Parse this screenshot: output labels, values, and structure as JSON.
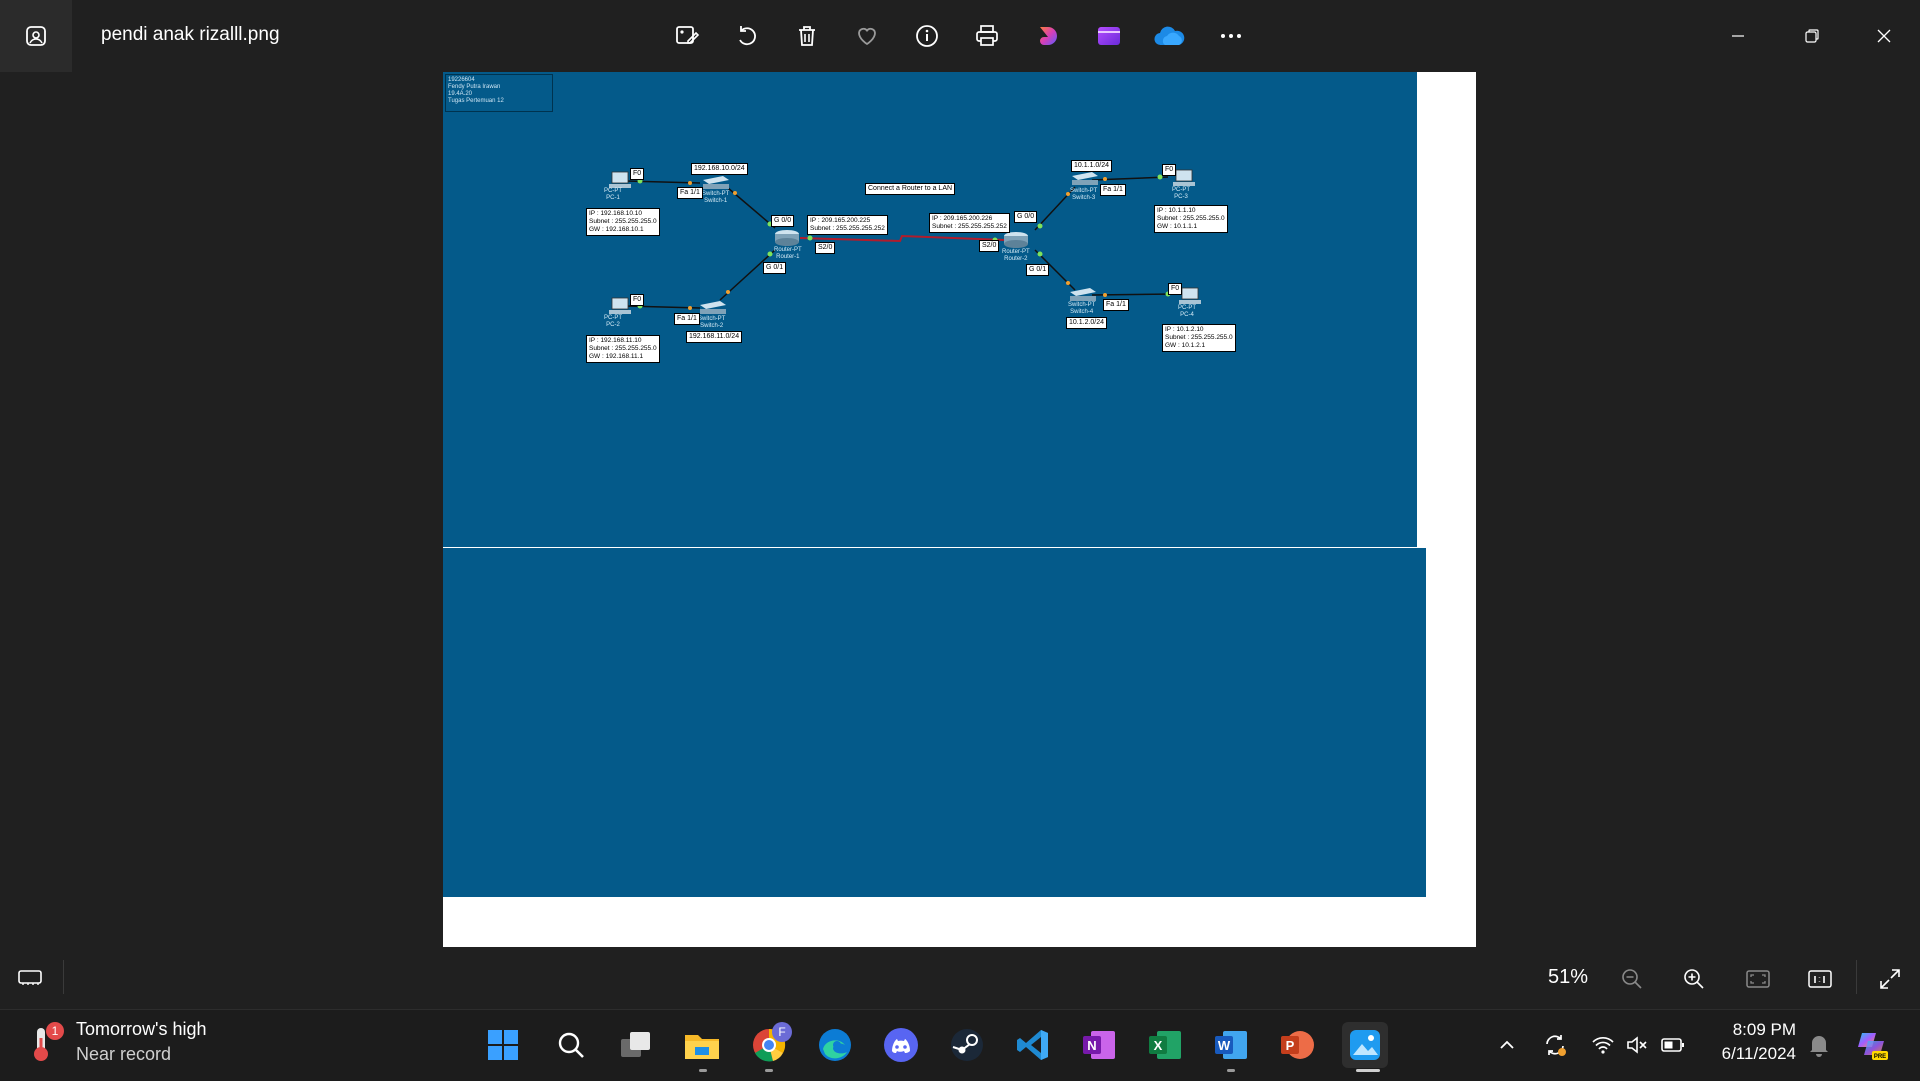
{
  "window": {
    "title": "pendi anak rizalll.png",
    "toolbar": [
      "edit-image",
      "rotate",
      "delete",
      "favorite",
      "file-info",
      "print",
      "ai-designer",
      "clipchamp",
      "onedrive",
      "more-options"
    ]
  },
  "diagram": {
    "note_lines": [
      "19226604",
      "Fendy Putra Irawan",
      "19.4A.20",
      "Tugas Pertemuan 12"
    ],
    "title_label": "Connect a Router to a LAN",
    "nets": {
      "lan1": "192.168.10.0/24",
      "lan2": "192.168.11.0/24",
      "lan3": "10.1.1.0/24",
      "lan4": "10.1.2.0/24"
    },
    "ports": {
      "f0": "F0",
      "fa11": "Fa 1/1",
      "g00": "G 0/0",
      "g01": "G 0/1",
      "s20": "S2/0"
    },
    "devices": {
      "pc1": "PC-PT\nPC-1",
      "pc2": "PC-PT\nPC-2",
      "pc3": "PC-PT\nPC-3",
      "pc4": "PC-PT\nPC-4",
      "sw1": "Switch-PT\nSwitch-1",
      "sw2": "Switch-PT\nSwitch-2",
      "sw3": "Switch-PT\nSwitch-3",
      "sw4": "Switch-PT\nSwitch-4",
      "r1": "Router-PT\nRouter-1",
      "r2": "Router-PT\nRouter-2"
    },
    "info": {
      "pc1": [
        "IP : 192.168.10.10",
        "Subnet : 255.255.255.0",
        "GW : 192.168.10.1"
      ],
      "pc2": [
        "IP : 192.168.11.10",
        "Subnet : 255.255.255.0",
        "GW : 192.168.11.1"
      ],
      "pc3": [
        "IP : 10.1.1.10",
        "Subnet : 255.255.255.0",
        "GW : 10.1.1.1"
      ],
      "pc4": [
        "IP : 10.1.2.10",
        "Subnet : 255.255.255.0",
        "GW : 10.1.2.1"
      ],
      "r1": [
        "IP : 209.165.200.225",
        "Subnet : 255.255.255.252"
      ],
      "r2": [
        "IP : 209.165.200.226",
        "Subnet : 255.255.255.252"
      ]
    }
  },
  "bottombar": {
    "zoom": "51%"
  },
  "taskbar": {
    "weather_title": "Tomorrow's high",
    "weather_sub": "Near record",
    "weather_badge": "1",
    "chrome_badge": "F",
    "time": "8:09 PM",
    "date": "6/11/2024"
  },
  "colors": {
    "canvas_blue": "#045a8a",
    "serial_link": "#b11c2c",
    "background": "#202020"
  }
}
